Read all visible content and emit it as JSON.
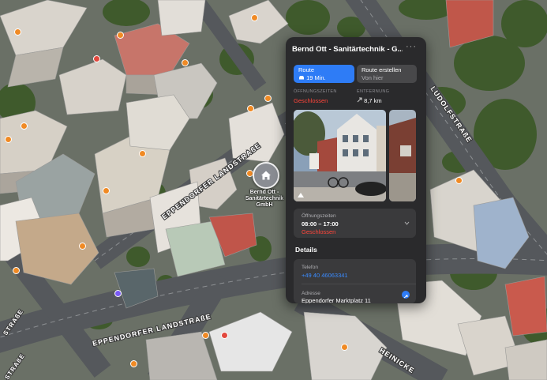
{
  "map": {
    "road_labels": [
      "EPPENDORFER LANDSTRAßE",
      "EPPENDORFER LANDSTRAßE",
      "LUDOLFSTRAßE",
      "HEINICKE",
      "STRAßE",
      "STRAßE"
    ],
    "poi_label": "Bernd Ott - Sanitärtechnik GmbH",
    "poi_icon": "house-icon"
  },
  "panel": {
    "title": "Bernd Ott - Sanitärtechnik - G...",
    "more": "···",
    "route_button": {
      "label": "Route",
      "sub": "19 Min.",
      "icon": "car-icon"
    },
    "create_route_button": {
      "label": "Route erstellen",
      "sub": "Von hier"
    },
    "opening_hours_head": "ÖFFNUNGSZEITEN",
    "status": "Geschlossen",
    "distance_head": "ENTFERNUNG",
    "distance": "8,7 km",
    "hours_card": {
      "label": "Öffnungszeiten",
      "time": "08:00 – 17:00",
      "status": "Geschlossen"
    },
    "details_head": "Details",
    "phone": {
      "label": "Telefon",
      "value": "+49 40 46063341"
    },
    "address": {
      "label": "Adresse",
      "value": "Eppendorfer Marktplatz 11"
    }
  },
  "colors": {
    "accent": "#2e7cf6",
    "closed": "#ff453a",
    "link": "#3a8bff",
    "panel_bg": "#2a2a2c"
  }
}
